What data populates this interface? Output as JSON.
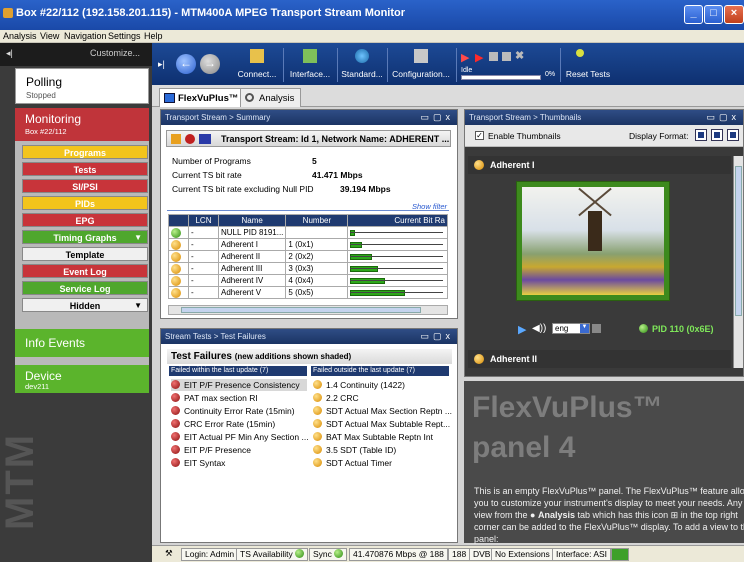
{
  "window": {
    "title": "Box #22/112 (192.158.201.115) - MTM400A MPEG Transport Stream Monitor"
  },
  "menu": [
    "Analysis",
    "View",
    "Navigation",
    "Settings",
    "Help"
  ],
  "left": {
    "customize": "Customize...",
    "polling": {
      "title": "Polling",
      "status": "Stopped"
    },
    "monitoring": {
      "title": "Monitoring",
      "sub": "Box #22/112"
    },
    "buttons": [
      {
        "label": "Programs",
        "color": "yellow"
      },
      {
        "label": "Tests",
        "color": "red"
      },
      {
        "label": "SI/PSI",
        "color": "red"
      },
      {
        "label": "PIDs",
        "color": "yellow"
      },
      {
        "label": "EPG",
        "color": "red"
      },
      {
        "label": "Timing Graphs",
        "color": "green"
      },
      {
        "label": "Template",
        "color": "white"
      },
      {
        "label": "Event Log",
        "color": "red"
      },
      {
        "label": "Service Log",
        "color": "green"
      },
      {
        "label": "Hidden",
        "color": "white"
      }
    ],
    "info_events": "Info Events",
    "device": {
      "title": "Device",
      "sub": "dev211"
    },
    "watermark": "MTM"
  },
  "toolbar": {
    "connect": "Connect...",
    "interface": "Interface...",
    "standard": "Standard...",
    "configuration": "Configuration...",
    "idle": "Idle",
    "progress": "0%",
    "reset": "Reset Tests"
  },
  "tabs": [
    "FlexVuPlus™",
    "Analysis"
  ],
  "summary": {
    "header": "Transport Stream > Summary",
    "ts_name": "Transport Stream: Id 1, Network Name: ADHERENT ...",
    "rows": [
      {
        "label": "Number of Programs",
        "value": "5"
      },
      {
        "label": "Current TS bit rate",
        "value": "41.471 Mbps"
      },
      {
        "label": "Current TS bit rate excluding Null PID",
        "value": "39.194 Mbps"
      }
    ],
    "show_filter": "Show filter",
    "columns": [
      "LCN",
      "Name",
      "Number",
      "Current Bit Ra"
    ],
    "programs": [
      {
        "status": "green",
        "lcn": "-",
        "name": "NULL PID 8191...",
        "number": "",
        "bar": 0.05
      },
      {
        "status": "orange",
        "lcn": "-",
        "name": "Adherent I",
        "number": "1 (0x1)",
        "bar": 0.12
      },
      {
        "status": "orange",
        "lcn": "-",
        "name": "Adherent II",
        "number": "2 (0x2)",
        "bar": 0.22
      },
      {
        "status": "orange",
        "lcn": "-",
        "name": "Adherent III",
        "number": "3 (0x3)",
        "bar": 0.28
      },
      {
        "status": "orange",
        "lcn": "-",
        "name": "Adherent IV",
        "number": "4 (0x4)",
        "bar": 0.35
      },
      {
        "status": "orange",
        "lcn": "-",
        "name": "Adherent V",
        "number": "5 (0x5)",
        "bar": 0.55
      }
    ]
  },
  "failures": {
    "header": "Stream Tests > Test Failures",
    "title": "Test Failures",
    "subtitle": "(new additions shown shaded)",
    "col_left": "Failed within the last update (7)",
    "col_right": "Failed outside the last update (7)",
    "left_items": [
      "EIT P/F Presence Consistency",
      "PAT max section RI",
      "Continuity Error Rate (15min)",
      "CRC Error Rate (15min)",
      "EIT Actual PF Min Any Section ...",
      "EIT P/F Presence",
      "EIT Syntax"
    ],
    "right_items": [
      "1.4 Continuity (1422)",
      "2.2 CRC",
      "SDT Actual Max Section Reptn ...",
      "SDT Actual Max Subtable Rept...",
      "BAT Max Subtable Reptn Int",
      "3.5 SDT (Table ID)",
      "SDT Actual Timer"
    ]
  },
  "thumbs": {
    "header": "Transport Stream > Thumbnails",
    "enable": "Enable Thumbnails",
    "display_format": "Display Format:",
    "program1": "Adherent I",
    "lang": "eng",
    "pid": "PID 110 (0x6E)",
    "program2": "Adherent II"
  },
  "panel4": {
    "title1": "FlexVuPlus™",
    "title2": "panel 4",
    "text_a": "This is an empty FlexVuPlus™ panel. The FlexVuPlus™ feature allows you to customize your instrument's display to meet your needs. Any view from the",
    "text_b": "Analysis",
    "text_c": "tab which has this icon",
    "text_d": "in the top right corner can be added to the FlexVuPlus™ display. To add a view to this panel:"
  },
  "status": {
    "login": "Login: Admin",
    "ts_avail": "TS Availability",
    "sync": "Sync",
    "rate": "41.470876 Mbps @ 188",
    "pkt": "188",
    "dvb": "DVB",
    "ext": "No Extensions",
    "iface": "Interface: ASI"
  }
}
